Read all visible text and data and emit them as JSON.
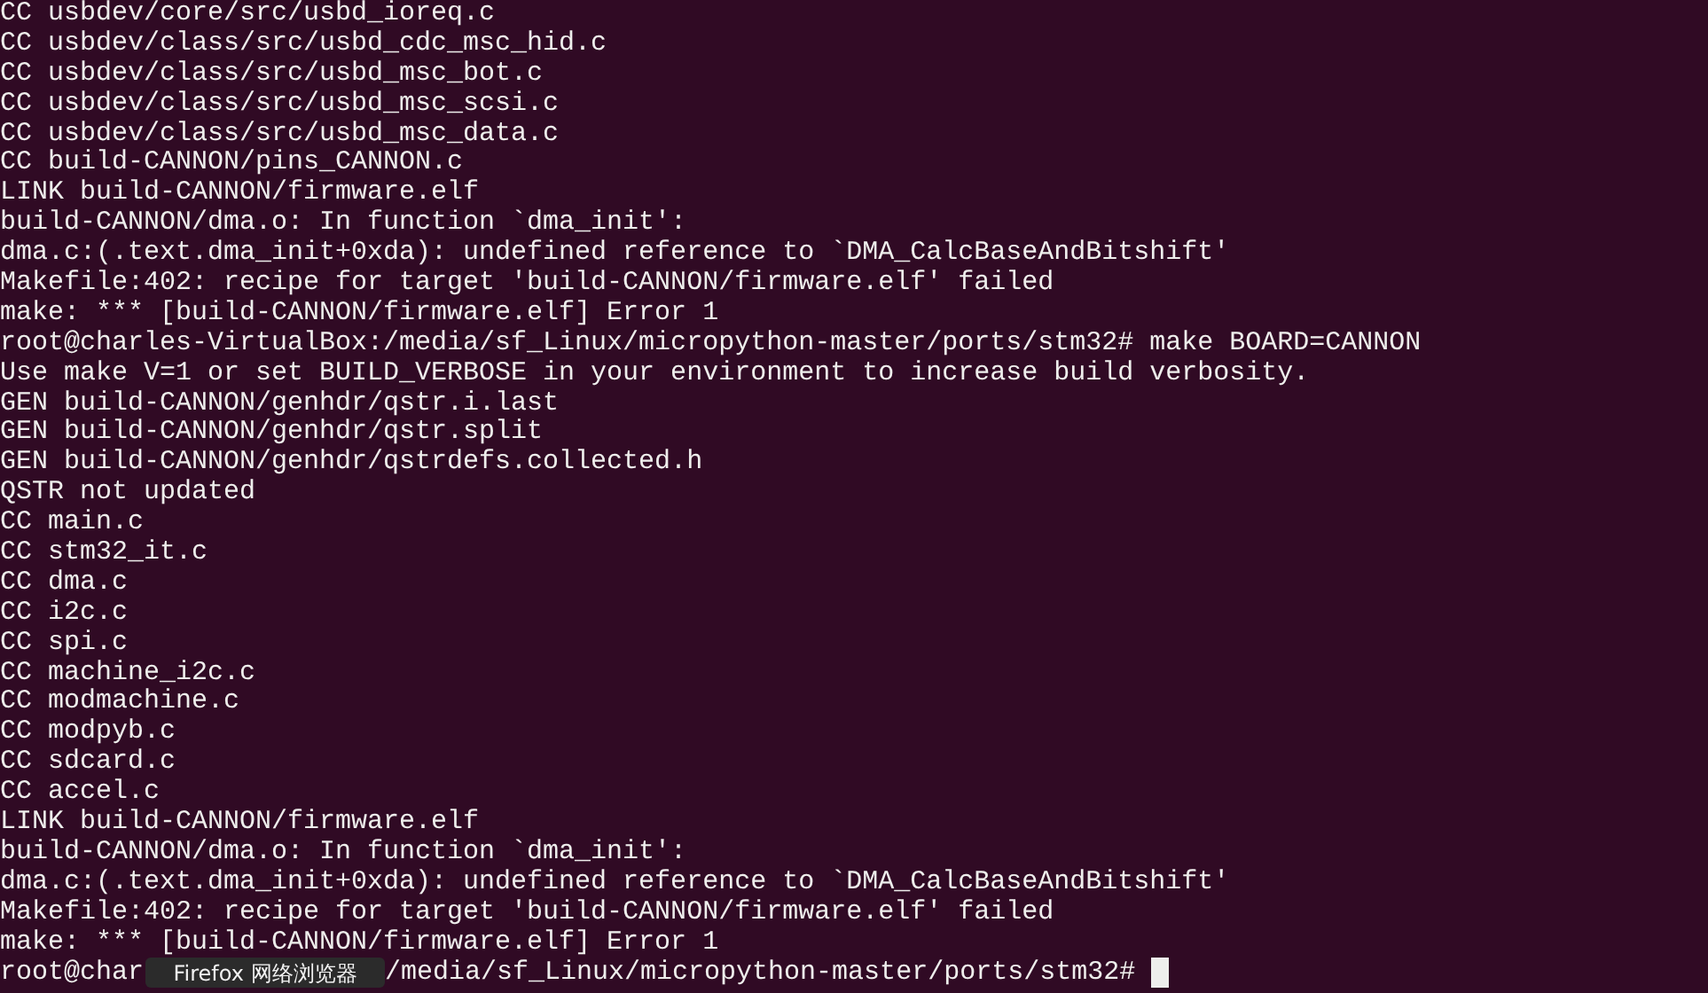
{
  "terminal": {
    "lines": [
      "CC usbdev/core/src/usbd_ioreq.c",
      "CC usbdev/class/src/usbd_cdc_msc_hid.c",
      "CC usbdev/class/src/usbd_msc_bot.c",
      "CC usbdev/class/src/usbd_msc_scsi.c",
      "CC usbdev/class/src/usbd_msc_data.c",
      "CC build-CANNON/pins_CANNON.c",
      "LINK build-CANNON/firmware.elf",
      "build-CANNON/dma.o: In function `dma_init':",
      "dma.c:(.text.dma_init+0xda): undefined reference to `DMA_CalcBaseAndBitshift'",
      "Makefile:402: recipe for target 'build-CANNON/firmware.elf' failed",
      "make: *** [build-CANNON/firmware.elf] Error 1",
      "root@charles-VirtualBox:/media/sf_Linux/micropython-master/ports/stm32# make BOARD=CANNON",
      "Use make V=1 or set BUILD_VERBOSE in your environment to increase build verbosity.",
      "GEN build-CANNON/genhdr/qstr.i.last",
      "GEN build-CANNON/genhdr/qstr.split",
      "GEN build-CANNON/genhdr/qstrdefs.collected.h",
      "QSTR not updated",
      "CC main.c",
      "CC stm32_it.c",
      "CC dma.c",
      "CC i2c.c",
      "CC spi.c",
      "CC machine_i2c.c",
      "CC modmachine.c",
      "CC modpyb.c",
      "CC sdcard.c",
      "CC accel.c",
      "LINK build-CANNON/firmware.elf",
      "build-CANNON/dma.o: In function `dma_init':",
      "dma.c:(.text.dma_init+0xda): undefined reference to `DMA_CalcBaseAndBitshift'",
      "Makefile:402: recipe for target 'build-CANNON/firmware.elf' failed",
      "make: *** [build-CANNON/firmware.elf] Error 1"
    ],
    "prompt": {
      "visible_start": "root@char",
      "visible_end": "/media/sf_Linux/micropython-master/ports/stm32#"
    }
  },
  "tooltip": {
    "text": "Firefox 网络浏览器"
  }
}
